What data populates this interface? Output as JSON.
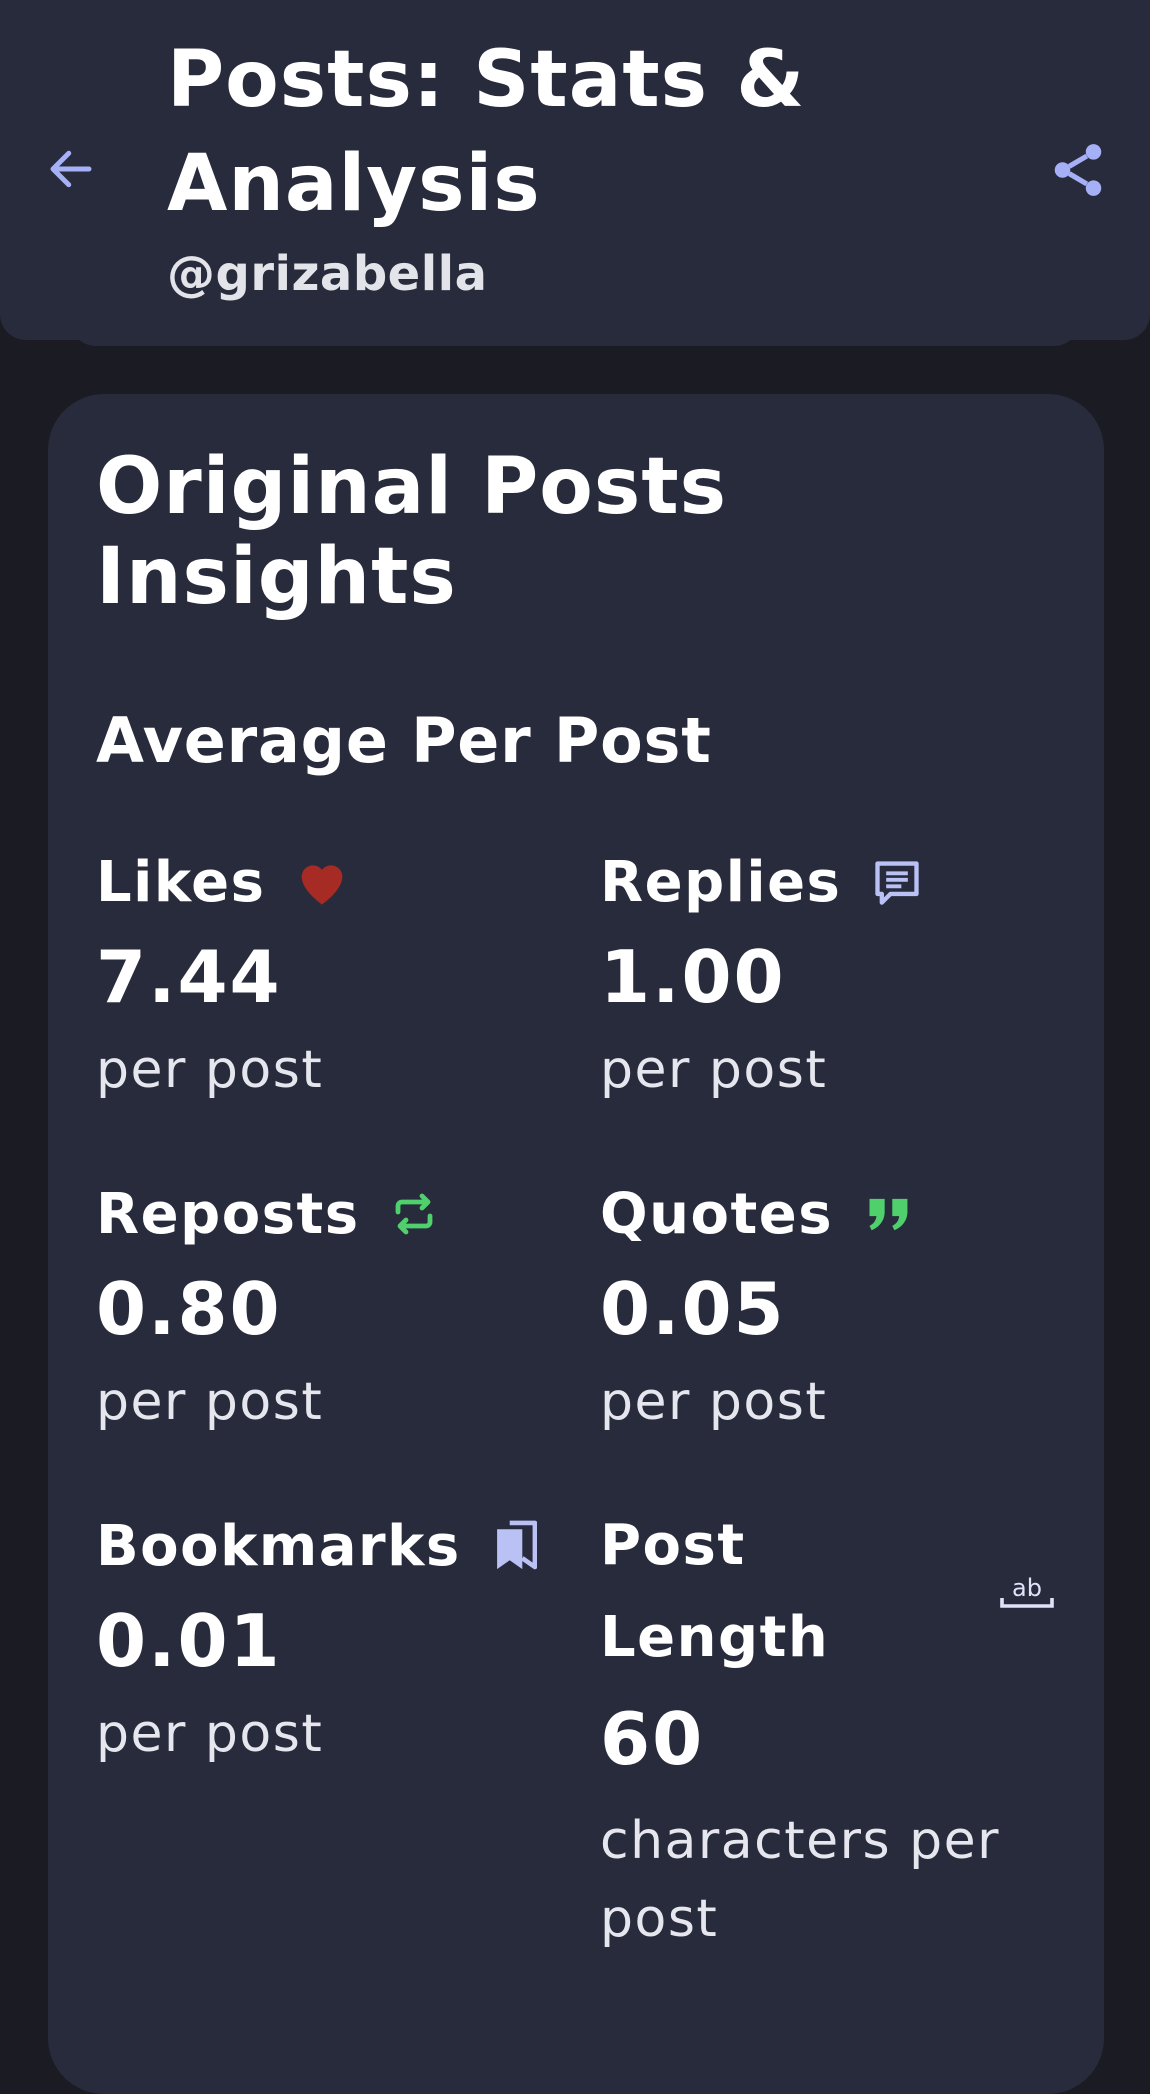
{
  "header": {
    "title": "Posts: Stats & Analysis",
    "handle": "@grizabella",
    "back_icon": "arrow-left-icon",
    "share_icon": "share-icon"
  },
  "card": {
    "title": "Original Posts Insights",
    "section_title": "Average Per Post"
  },
  "stats": {
    "likes": {
      "label": "Likes",
      "value": "7.44",
      "unit": "per post",
      "icon": "heart-icon",
      "icon_color": "#a52b24"
    },
    "replies": {
      "label": "Replies",
      "value": "1.00",
      "unit": "per post",
      "icon": "comment-icon",
      "icon_color": "#b9c1f5"
    },
    "reposts": {
      "label": "Reposts",
      "value": "0.80",
      "unit": "per post",
      "icon": "repost-icon",
      "icon_color": "#4fd06c"
    },
    "quotes": {
      "label": "Quotes",
      "value": "0.05",
      "unit": "per post",
      "icon": "quote-icon",
      "icon_color": "#4fd06c"
    },
    "bookmarks": {
      "label": "Bookmarks",
      "value": "0.01",
      "unit": "per post",
      "icon": "bookmark-icon",
      "icon_color": "#b9c1f5"
    },
    "post_length": {
      "label": "Post Length",
      "value": "60",
      "unit": "characters per post",
      "icon": "text-length-icon",
      "icon_color": "#b9c1f5"
    }
  },
  "colors": {
    "background": "#1b1c23",
    "surface": "#282b3b",
    "accent": "#a6b0f7"
  }
}
